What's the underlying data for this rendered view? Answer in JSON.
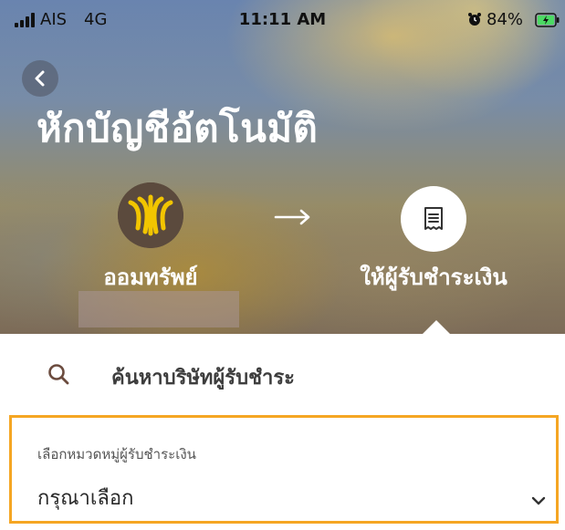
{
  "status_bar": {
    "carrier": "AIS",
    "network": "4G",
    "time": "11:11 AM",
    "battery": "84%",
    "icons": [
      "signal-icon",
      "alarm-icon",
      "battery-charging-icon"
    ]
  },
  "header": {
    "back_icon": "chevron-left-icon",
    "title": "หักบัญชีอัตโนมัติ",
    "source_label": "ออมทรัพย์",
    "arrow_icon": "arrow-right-icon",
    "dest_icon": "receipt-icon",
    "dest_label": "ให้ผู้รับชำระเงิน"
  },
  "search": {
    "icon": "search-icon",
    "label": "ค้นหาบริษัทผู้รับชำระ"
  },
  "category": {
    "label": "เลือกหมวดหมู่ผู้รับชำระเงิน",
    "value": "กรุณาเลือก",
    "icon": "chevron-down-icon"
  },
  "colors": {
    "highlight_border": "#f5a623",
    "bank_logo_bg": "#5b4a3d",
    "bank_logo_fg": "#f2c500",
    "title_text": "#ffffff"
  }
}
